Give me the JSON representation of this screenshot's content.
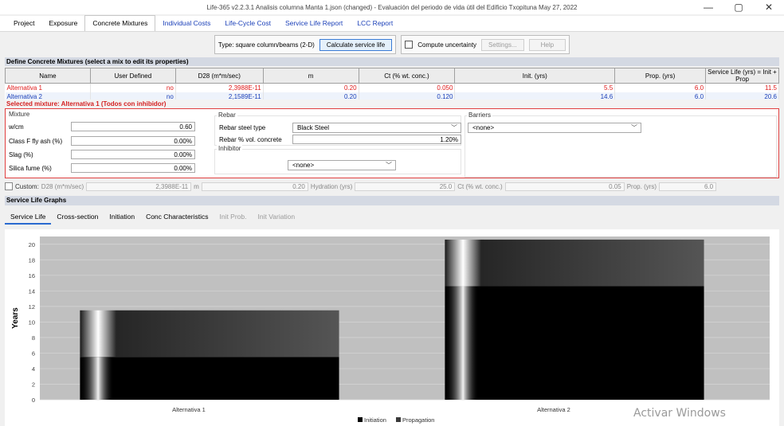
{
  "window": {
    "title": "Life-365 v2.2.3.1 Analisis columna Manta 1.json (changed) - Evaluación del periodo de vida útil del Edificio Txopituna May 27, 2022",
    "controls": [
      "—",
      "▢",
      "✕"
    ]
  },
  "menu": [
    {
      "label": "Project",
      "style": "normal"
    },
    {
      "label": "Exposure",
      "style": "normal"
    },
    {
      "label": "Concrete Mixtures",
      "style": "active"
    },
    {
      "label": "Individual Costs",
      "style": "blue"
    },
    {
      "label": "Life-Cycle Cost",
      "style": "blue"
    },
    {
      "label": "Service Life Report",
      "style": "blue"
    },
    {
      "label": "LCC Report",
      "style": "blue"
    }
  ],
  "toolbar": {
    "type_label": "Type: square column/beams (2-D)",
    "calc_button": "Calculate service life",
    "uncertainty_label": "Compute uncertainty",
    "settings_button": "Settings...",
    "help_button": "Help"
  },
  "mixtures": {
    "header": "Define Concrete Mixtures (select a mix to edit its properties)",
    "columns": [
      "Name",
      "User Defined",
      "D28 (m*m/sec)",
      "m",
      "Ct (% wt. conc.)",
      "Init. (yrs)",
      "Prop. (yrs)",
      "Service Life (yrs) = Init + Prop"
    ],
    "rows": [
      [
        "Alternativa 1",
        "no",
        "2,3988E-11",
        "0.20",
        "0.050",
        "5.5",
        "6.0",
        "11.5"
      ],
      [
        "Alternativa 2",
        "no",
        "2,1589E-11",
        "0.20",
        "0.120",
        "14.6",
        "6.0",
        "20.6"
      ]
    ]
  },
  "selected": {
    "header": "Selected mixture: Alternativa 1 (Todos con inhibidor)",
    "mixture_legend": "Mixture",
    "wcm_label": "w/cm",
    "wcm_value": "0.60",
    "flyash_label": "Class F fly ash (%)",
    "flyash_value": "0.00%",
    "slag_label": "Slag (%)",
    "slag_value": "0.00%",
    "silica_label": "Silica fume (%)",
    "silica_value": "0.00%",
    "rebar_legend": "Rebar",
    "steel_label": "Rebar steel type",
    "steel_value": "Black Steel",
    "vol_label": "Rebar % vol. concrete",
    "vol_value": "1.20%",
    "inhibitor_legend": "Inhibitor",
    "inhibitor_value": "<none>",
    "barriers_legend": "Barriers",
    "barriers_value": "<none>"
  },
  "custom": {
    "label": "Custom:",
    "d28_label": "D28 (m*m/sec)",
    "d28_value": "2,3988E-11",
    "m_label": "m",
    "m_value": "0.20",
    "hyd_label": "Hydration (yrs)",
    "hyd_value": "25.0",
    "ct_label": "Ct (% wt. conc.)",
    "ct_value": "0.05",
    "prop_label": "Prop. (yrs)",
    "prop_value": "6.0"
  },
  "graphs": {
    "header": "Service Life Graphs",
    "tabs": [
      {
        "label": "Service Life",
        "state": "active"
      },
      {
        "label": "Cross-section",
        "state": "normal"
      },
      {
        "label": "Initiation",
        "state": "normal"
      },
      {
        "label": "Conc Characteristics",
        "state": "normal"
      },
      {
        "label": "Init Prob.",
        "state": "dim"
      },
      {
        "label": "Init Variation",
        "state": "dim"
      }
    ]
  },
  "chart_data": {
    "type": "bar",
    "stacked": true,
    "categories": [
      "Alternativa 1",
      "Alternativa 2"
    ],
    "series": [
      {
        "name": "Initiation",
        "values": [
          5.5,
          14.6
        ],
        "color": "#000000"
      },
      {
        "name": "Propagation",
        "values": [
          6.0,
          6.0
        ],
        "color": "#3a3a3a"
      }
    ],
    "ylabel": "Years",
    "ylim": [
      0,
      21
    ],
    "yticks": [
      0,
      2,
      4,
      6,
      8,
      10,
      12,
      14,
      16,
      18,
      20
    ],
    "grid": true,
    "legend": "bottom-center",
    "background": "#c0c0c0"
  },
  "watermark": "Activar Windows"
}
